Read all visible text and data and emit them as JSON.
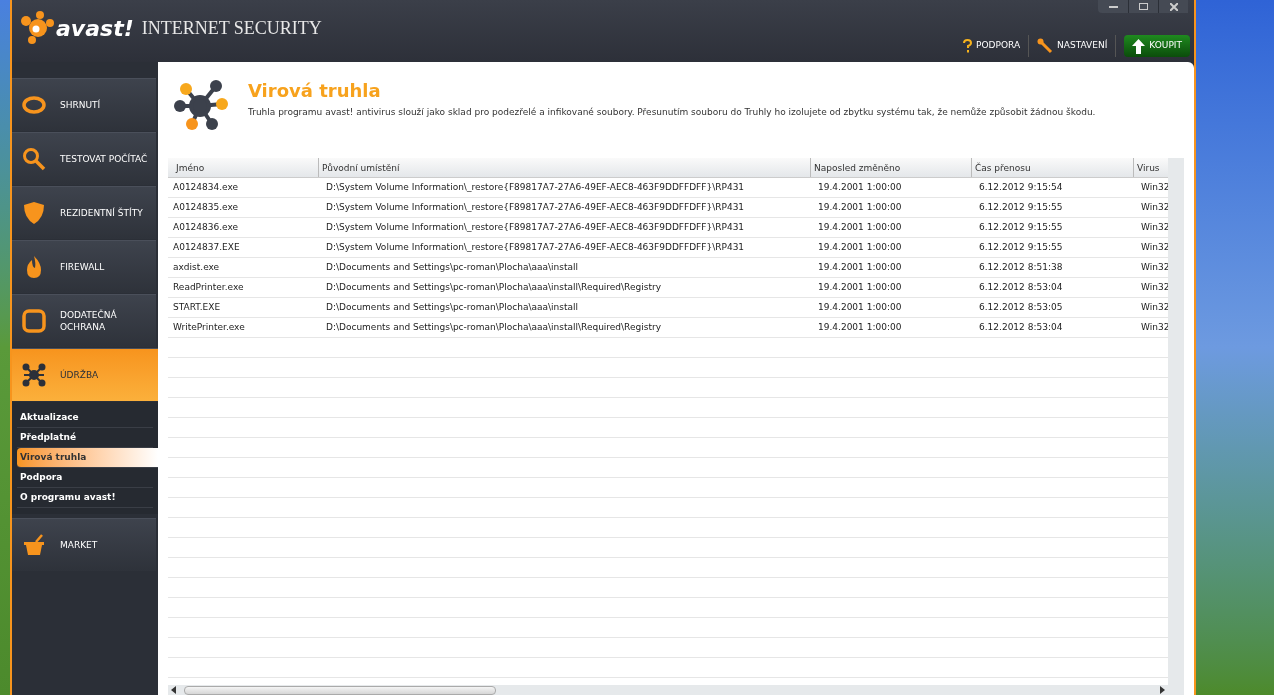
{
  "window": {
    "brand": "avast!",
    "title": "INTERNET SECURITY"
  },
  "toolbar": [
    {
      "kind": "help",
      "label": "PODPORA"
    },
    {
      "kind": "settings",
      "label": "NASTAVENÍ"
    },
    {
      "kind": "buy",
      "label": "KOUPIT"
    }
  ],
  "sidebar": {
    "items": [
      {
        "kind": "summary",
        "label": "SHRNUTÍ",
        "selected": false
      },
      {
        "kind": "scan",
        "label": "TESTOVAT POČÍTAČ",
        "selected": false
      },
      {
        "kind": "shield",
        "label": "REZIDENTNÍ ŠTÍTY",
        "selected": false
      },
      {
        "kind": "fire",
        "label": "FIREWALL",
        "selected": false
      },
      {
        "kind": "box",
        "label": "DODATEČNÁ OCHRANA",
        "selected": false
      },
      {
        "kind": "maintenance",
        "label": "ÚDRŽBA",
        "selected": true,
        "children": [
          {
            "label": "Aktualizace",
            "selected": false
          },
          {
            "label": "Předplatné",
            "selected": false
          },
          {
            "label": "Virová truhla",
            "selected": true
          },
          {
            "label": "Podpora",
            "selected": false
          },
          {
            "label": "O programu avast!",
            "selected": false
          }
        ]
      },
      {
        "kind": "market",
        "label": "MARKET",
        "selected": false
      }
    ]
  },
  "page": {
    "title": "Virová truhla",
    "description": "Truhla programu avast! antivirus slouží jako sklad pro podezřelé a infikované soubory. Přesunutím souboru do Truhly ho izolujete od zbytku systému tak, že nemůže způsobit žádnou škodu."
  },
  "table": {
    "columns": [
      "Jméno",
      "Původní umístění",
      "Naposled změněno",
      "Čas přenosu",
      "Virus"
    ],
    "rows": [
      [
        "A0124834.exe",
        "D:\\System Volume Information\\_restore{F89817A7-27A6-49EF-AEC8-463F9DDFFDFF}\\RP431",
        "19.4.2001 1:00:00",
        "6.12.2012 9:15:54",
        "Win32"
      ],
      [
        "A0124835.exe",
        "D:\\System Volume Information\\_restore{F89817A7-27A6-49EF-AEC8-463F9DDFFDFF}\\RP431",
        "19.4.2001 1:00:00",
        "6.12.2012 9:15:55",
        "Win32"
      ],
      [
        "A0124836.exe",
        "D:\\System Volume Information\\_restore{F89817A7-27A6-49EF-AEC8-463F9DDFFDFF}\\RP431",
        "19.4.2001 1:00:00",
        "6.12.2012 9:15:55",
        "Win32"
      ],
      [
        "A0124837.EXE",
        "D:\\System Volume Information\\_restore{F89817A7-27A6-49EF-AEC8-463F9DDFFDFF}\\RP431",
        "19.4.2001 1:00:00",
        "6.12.2012 9:15:55",
        "Win32"
      ],
      [
        "axdist.exe",
        "D:\\Documents and Settings\\pc-roman\\Plocha\\aaa\\install",
        "19.4.2001 1:00:00",
        "6.12.2012 8:51:38",
        "Win32"
      ],
      [
        "ReadPrinter.exe",
        "D:\\Documents and Settings\\pc-roman\\Plocha\\aaa\\install\\Required\\Registry",
        "19.4.2001 1:00:00",
        "6.12.2012 8:53:04",
        "Win32"
      ],
      [
        "START.EXE",
        "D:\\Documents and Settings\\pc-roman\\Plocha\\aaa\\install",
        "19.4.2001 1:00:00",
        "6.12.2012 8:53:05",
        "Win32"
      ],
      [
        "WritePrinter.exe",
        "D:\\Documents and Settings\\pc-roman\\Plocha\\aaa\\install\\Required\\Registry",
        "19.4.2001 1:00:00",
        "6.12.2012 8:53:04",
        "Win32"
      ]
    ]
  }
}
